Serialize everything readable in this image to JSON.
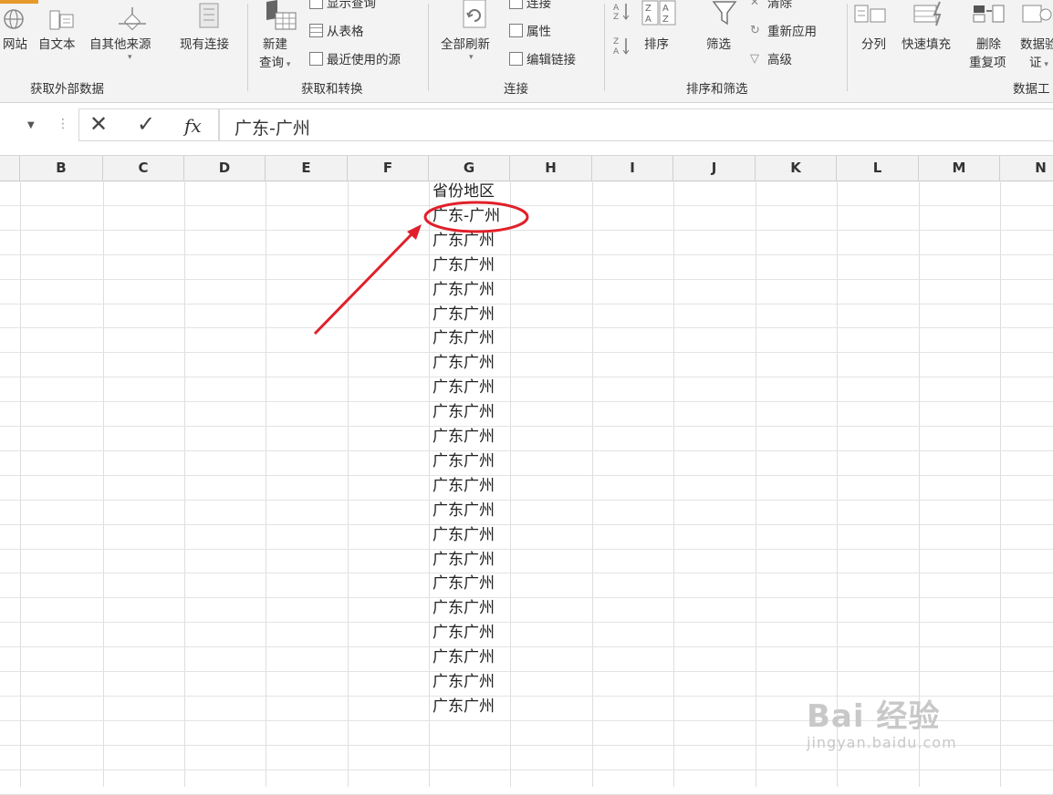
{
  "ribbon": {
    "get_external_data": {
      "from_web": "网站",
      "from_text": "自文本",
      "from_other": "自其他来源",
      "existing_conn": "现有连接",
      "group_label": "获取外部数据"
    },
    "get_transform": {
      "new_query": "新建",
      "new_query_2": "查询",
      "show_queries": "显示查询",
      "from_table": "从表格",
      "recent_sources": "最近使用的源",
      "group_label": "获取和转换"
    },
    "connections": {
      "refresh_all": "全部刷新",
      "connections": "连接",
      "properties": "属性",
      "edit_links": "编辑链接",
      "group_label": "连接"
    },
    "sort_filter": {
      "sort": "排序",
      "filter": "筛选",
      "clear": "清除",
      "reapply": "重新应用",
      "advanced": "高级",
      "group_label": "排序和筛选"
    },
    "data_tools": {
      "text_to_columns": "分列",
      "flash_fill": "快速填充",
      "remove_dup": "删除",
      "remove_dup_2": "重复项",
      "validation": "数据验",
      "validation_2": "证",
      "group_label": "数据工"
    }
  },
  "formula_bar": {
    "fx_label": "fx",
    "value": "广东-广州"
  },
  "columns": [
    "B",
    "C",
    "D",
    "E",
    "F",
    "G",
    "H",
    "I",
    "J",
    "K",
    "L",
    "M",
    "N"
  ],
  "column_g_cells": [
    "省份地区",
    "广东-广州",
    "广东广州",
    "广东广州",
    "广东广州",
    "广东广州",
    "广东广州",
    "广东广州",
    "广东广州",
    "广东广州",
    "广东广州",
    "广东广州",
    "广东广州",
    "广东广州",
    "广东广州",
    "广东广州",
    "广东广州",
    "广东广州",
    "广东广州",
    "广东广州",
    "广东广州",
    "广东广州"
  ],
  "annotation_color": "#e0202a",
  "watermark": {
    "main": "Bai 经验",
    "sub": "jingyan.baidu.com"
  }
}
